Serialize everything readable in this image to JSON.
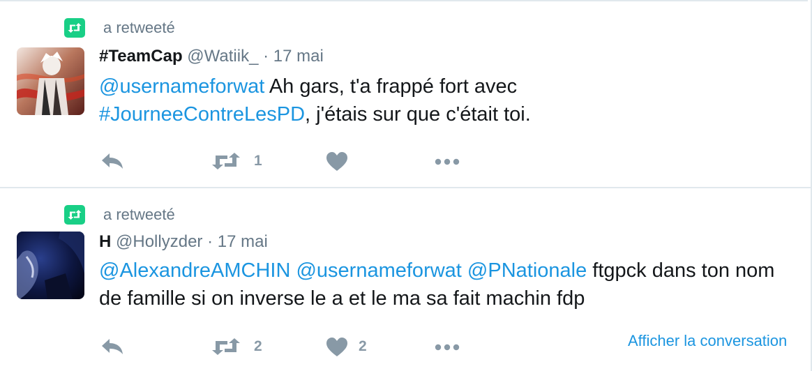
{
  "colors": {
    "retweet_green": "#19cf86",
    "link_blue": "#1b95e0",
    "secondary_gray": "#657786",
    "icon_gray": "#8899a6"
  },
  "tweets": [
    {
      "retweet_context": "a retweeté",
      "avatar_icon": "avatar-anime-character",
      "fullname": "#TeamCap",
      "username": "@Watiik_",
      "separator": "·",
      "time": "17 mai",
      "text": {
        "mention1": "@usernameforwat",
        "text1": " Ah gars, t'a frappé fort avec",
        "hashtag1": "#JourneeContreLesPD",
        "text2": ", j'étais sur que c'était toi."
      },
      "actions": {
        "retweet_count": "1",
        "like_count": ""
      }
    },
    {
      "retweet_context": "a retweeté",
      "avatar_icon": "avatar-dark-character",
      "fullname": "H",
      "username": "@Hollyzder",
      "separator": "·",
      "time": "17 mai",
      "text": {
        "mention1": "@AlexandreAMCHIN",
        "mention2": "@usernameforwat",
        "mention3": "@PNationale",
        "text1": " ftgpck dans ton nom de famille si on inverse le a et le ma sa fait machin fdp"
      },
      "actions": {
        "retweet_count": "2",
        "like_count": "2"
      },
      "conversation_link": "Afficher la conversation"
    }
  ]
}
